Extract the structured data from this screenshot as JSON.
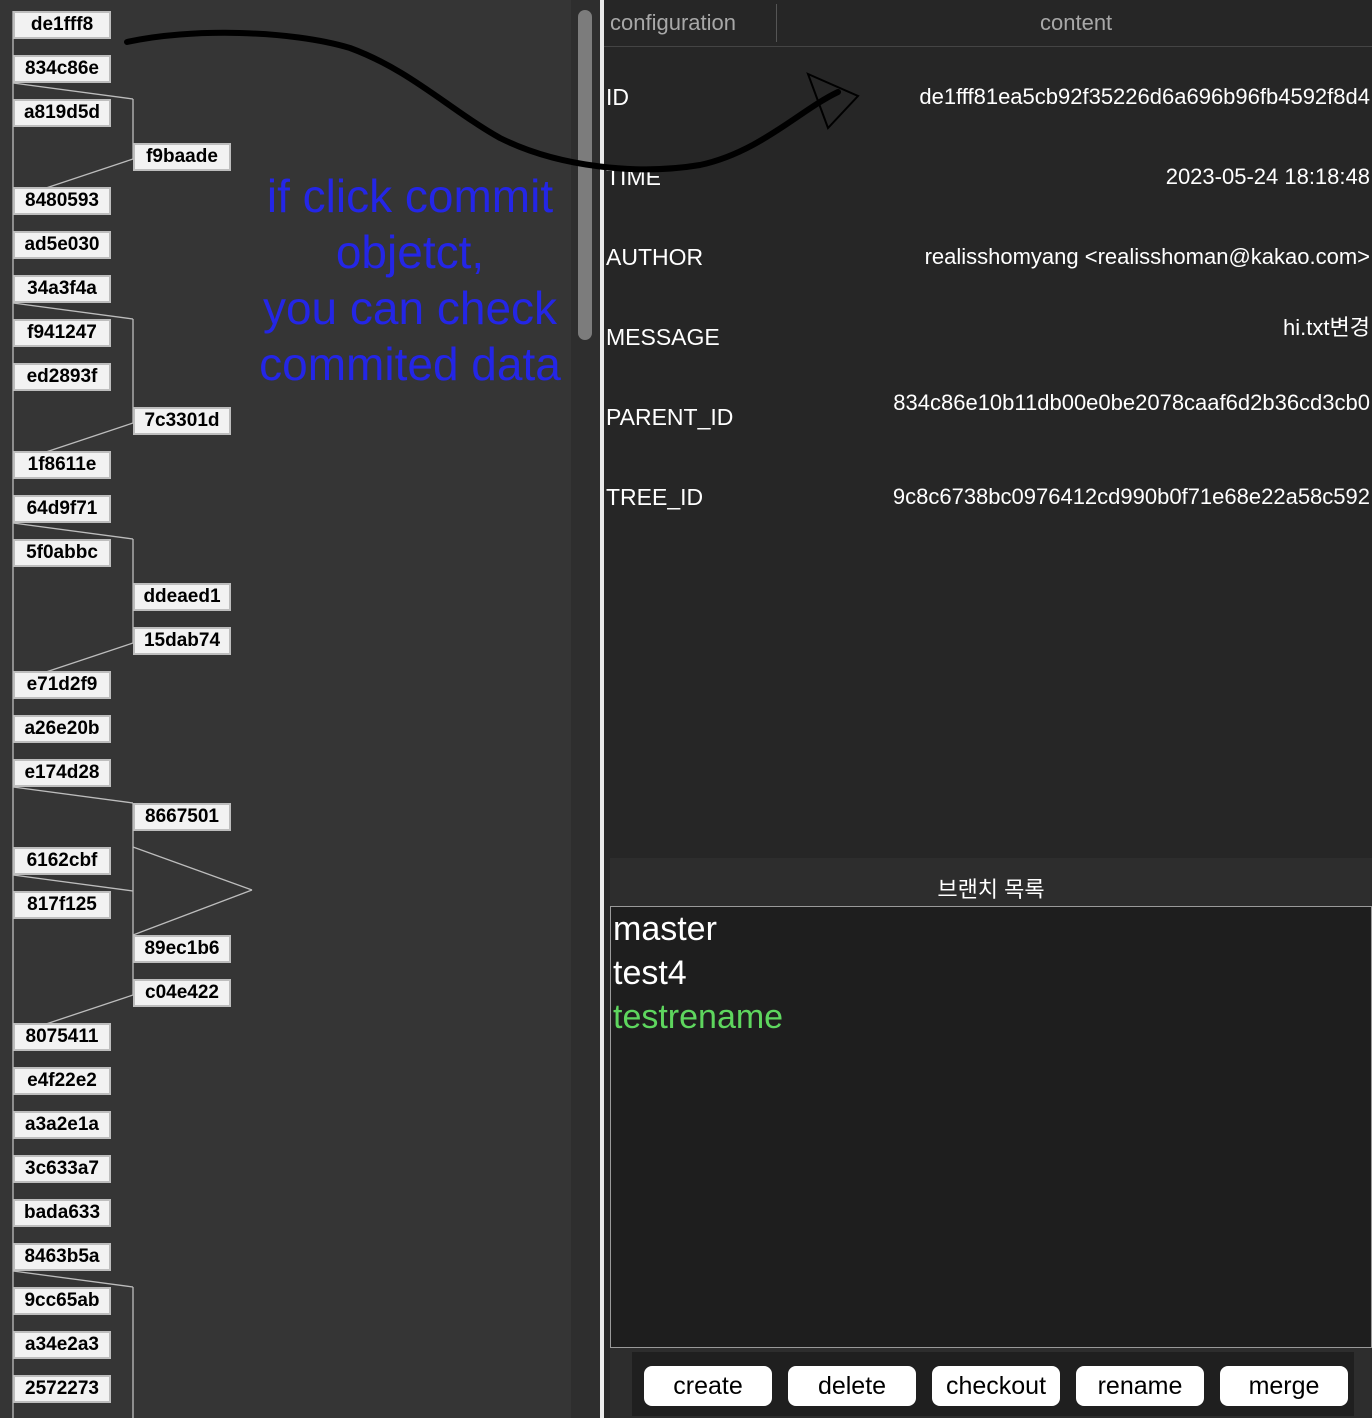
{
  "commit_graph": {
    "commits": [
      {
        "id": "de1fff8",
        "lane": 0
      },
      {
        "id": "834c86e",
        "lane": 0
      },
      {
        "id": "a819d5d",
        "lane": 0
      },
      {
        "id": "f9baade",
        "lane": 1
      },
      {
        "id": "8480593",
        "lane": 0
      },
      {
        "id": "ad5e030",
        "lane": 0
      },
      {
        "id": "34a3f4a",
        "lane": 0
      },
      {
        "id": "f941247",
        "lane": 0
      },
      {
        "id": "ed2893f",
        "lane": 0
      },
      {
        "id": "7c3301d",
        "lane": 1
      },
      {
        "id": "1f8611e",
        "lane": 0
      },
      {
        "id": "64d9f71",
        "lane": 0
      },
      {
        "id": "5f0abbc",
        "lane": 0
      },
      {
        "id": "ddeaed1",
        "lane": 1
      },
      {
        "id": "15dab74",
        "lane": 1
      },
      {
        "id": "e71d2f9",
        "lane": 0
      },
      {
        "id": "a26e20b",
        "lane": 0
      },
      {
        "id": "e174d28",
        "lane": 0
      },
      {
        "id": "8667501",
        "lane": 1
      },
      {
        "id": "6162cbf",
        "lane": 0
      },
      {
        "id": "817f125",
        "lane": 0
      },
      {
        "id": "89ec1b6",
        "lane": 1
      },
      {
        "id": "c04e422",
        "lane": 1
      },
      {
        "id": "8075411",
        "lane": 0
      },
      {
        "id": "e4f22e2",
        "lane": 0
      },
      {
        "id": "a3a2e1a",
        "lane": 0
      },
      {
        "id": "3c633a7",
        "lane": 0
      },
      {
        "id": "bada633",
        "lane": 0
      },
      {
        "id": "8463b5a",
        "lane": 0
      },
      {
        "id": "9cc65ab",
        "lane": 0
      },
      {
        "id": "a34e2a3",
        "lane": 0
      },
      {
        "id": "2572273",
        "lane": 0
      }
    ]
  },
  "annotation": {
    "lines": [
      "if click commit",
      "objetct,",
      "you can check",
      "commited data"
    ],
    "color": "#2426e6"
  },
  "details": {
    "header": {
      "configuration": "configuration",
      "content": "content"
    },
    "rows": [
      {
        "key": "ID",
        "value": "de1fff81ea5cb92f35226d6a696b96fb4592f8d4"
      },
      {
        "key": "TIME",
        "value": "2023-05-24 18:18:48"
      },
      {
        "key": "AUTHOR",
        "value": "realisshomyang <realisshoman@kakao.com>"
      },
      {
        "key": "MESSAGE",
        "value": "hi.txt변경"
      },
      {
        "key": "PARENT_ID",
        "value": "834c86e10b11db00e0be2078caaf6d2b36cd3cb0"
      },
      {
        "key": "TREE_ID",
        "value": "9c8c6738bc0976412cd990b0f71e68e22a58c592"
      }
    ]
  },
  "branches": {
    "title": "브랜치 목록",
    "items": [
      {
        "name": "master",
        "color": "#ffffff"
      },
      {
        "name": "test4",
        "color": "#ffffff"
      },
      {
        "name": "testrename",
        "color": "#5ed65e"
      }
    ]
  },
  "buttons": {
    "create": "create",
    "delete": "delete",
    "checkout": "checkout",
    "rename": "rename",
    "merge": "merge"
  }
}
